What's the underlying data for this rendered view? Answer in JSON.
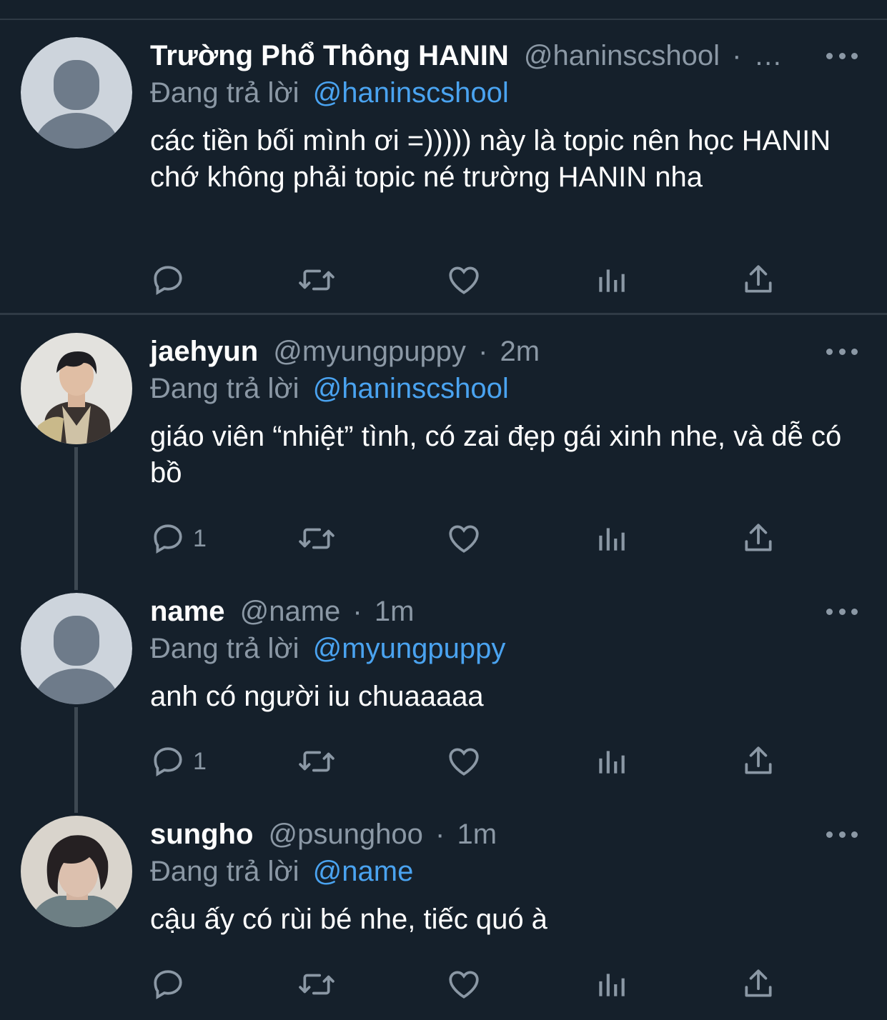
{
  "tweets": [
    {
      "display_name": "Trường Phổ Thông HANIN",
      "handle": "@haninscshool",
      "separator": "·",
      "time": "…",
      "reply_prefix": "Đang trả lời",
      "reply_to": "@haninscshool",
      "body": "các tiền bối mình ơi =))))) này là topic nên học HANIN chớ không phải topic né trường HANIN nha",
      "avatar": "default-avatar",
      "reply_count": ""
    },
    {
      "display_name": "jaehyun",
      "handle": "@myungpuppy",
      "separator": "·",
      "time": "2m",
      "reply_prefix": "Đang trả lời",
      "reply_to": "@haninscshool",
      "body": "giáo viên “nhiệt” tình, có zai đẹp gái xinh nhe, và dễ có bồ",
      "avatar": "photo-avatar",
      "reply_count": "1"
    },
    {
      "display_name": "name",
      "handle": "@name",
      "separator": "·",
      "time": "1m",
      "reply_prefix": "Đang trả lời",
      "reply_to": "@myungpuppy",
      "body": "anh có người iu chuaaaaa",
      "avatar": "default-avatar",
      "reply_count": "1"
    },
    {
      "display_name": "sungho",
      "handle": "@psunghoo",
      "separator": "·",
      "time": "1m",
      "reply_prefix": "Đang trả lời",
      "reply_to": "@name",
      "body": "cậu ấy có rùi bé nhe, tiếc quó à",
      "avatar": "photo-avatar",
      "reply_count": ""
    }
  ],
  "icons": {
    "reply": "speech-bubble-icon",
    "retweet": "retweet-icon",
    "like": "heart-icon",
    "analytics": "bar-chart-icon",
    "share": "share-upload-icon",
    "more": "ellipsis-icon"
  },
  "colors": {
    "background": "#15202b",
    "text": "#ffffff",
    "muted": "#8b98a5",
    "link": "#4aa3f0",
    "divider": "#2f3a45"
  }
}
